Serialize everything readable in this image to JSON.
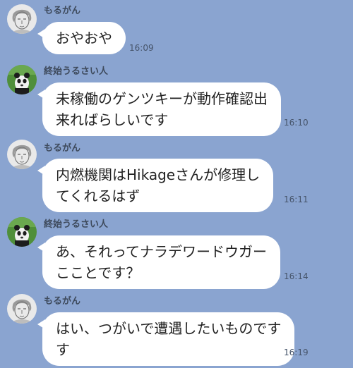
{
  "messages": [
    {
      "sender": "もるがん",
      "avatar": "sketch-face-avatar",
      "lines": [
        "おやおや"
      ],
      "time": "16:09"
    },
    {
      "sender": "終始うるさい人",
      "avatar": "panda-avatar",
      "lines": [
        "未稼働のゲンツキーが動作確認出",
        "来ればらしいです"
      ],
      "time": "16:10"
    },
    {
      "sender": "もるがん",
      "avatar": "sketch-face-avatar",
      "lines": [
        "内燃機関はHikageさんが修理し",
        "てくれるはず"
      ],
      "time": "16:11"
    },
    {
      "sender": "終始うるさい人",
      "avatar": "panda-avatar",
      "lines": [
        "あ、それってナラデワードウガー",
        "こことです？"
      ],
      "time": "16:14"
    },
    {
      "sender": "もるがん",
      "avatar": "sketch-face-avatar",
      "lines": [
        "はい、つがいで遭遇したいものです",
        "す"
      ],
      "time": "16:19"
    }
  ],
  "colors": {
    "background": "#8aa4d0",
    "bubble": "#ffffff",
    "sender_text": "#3e4a5c",
    "time_text": "#46546a"
  }
}
